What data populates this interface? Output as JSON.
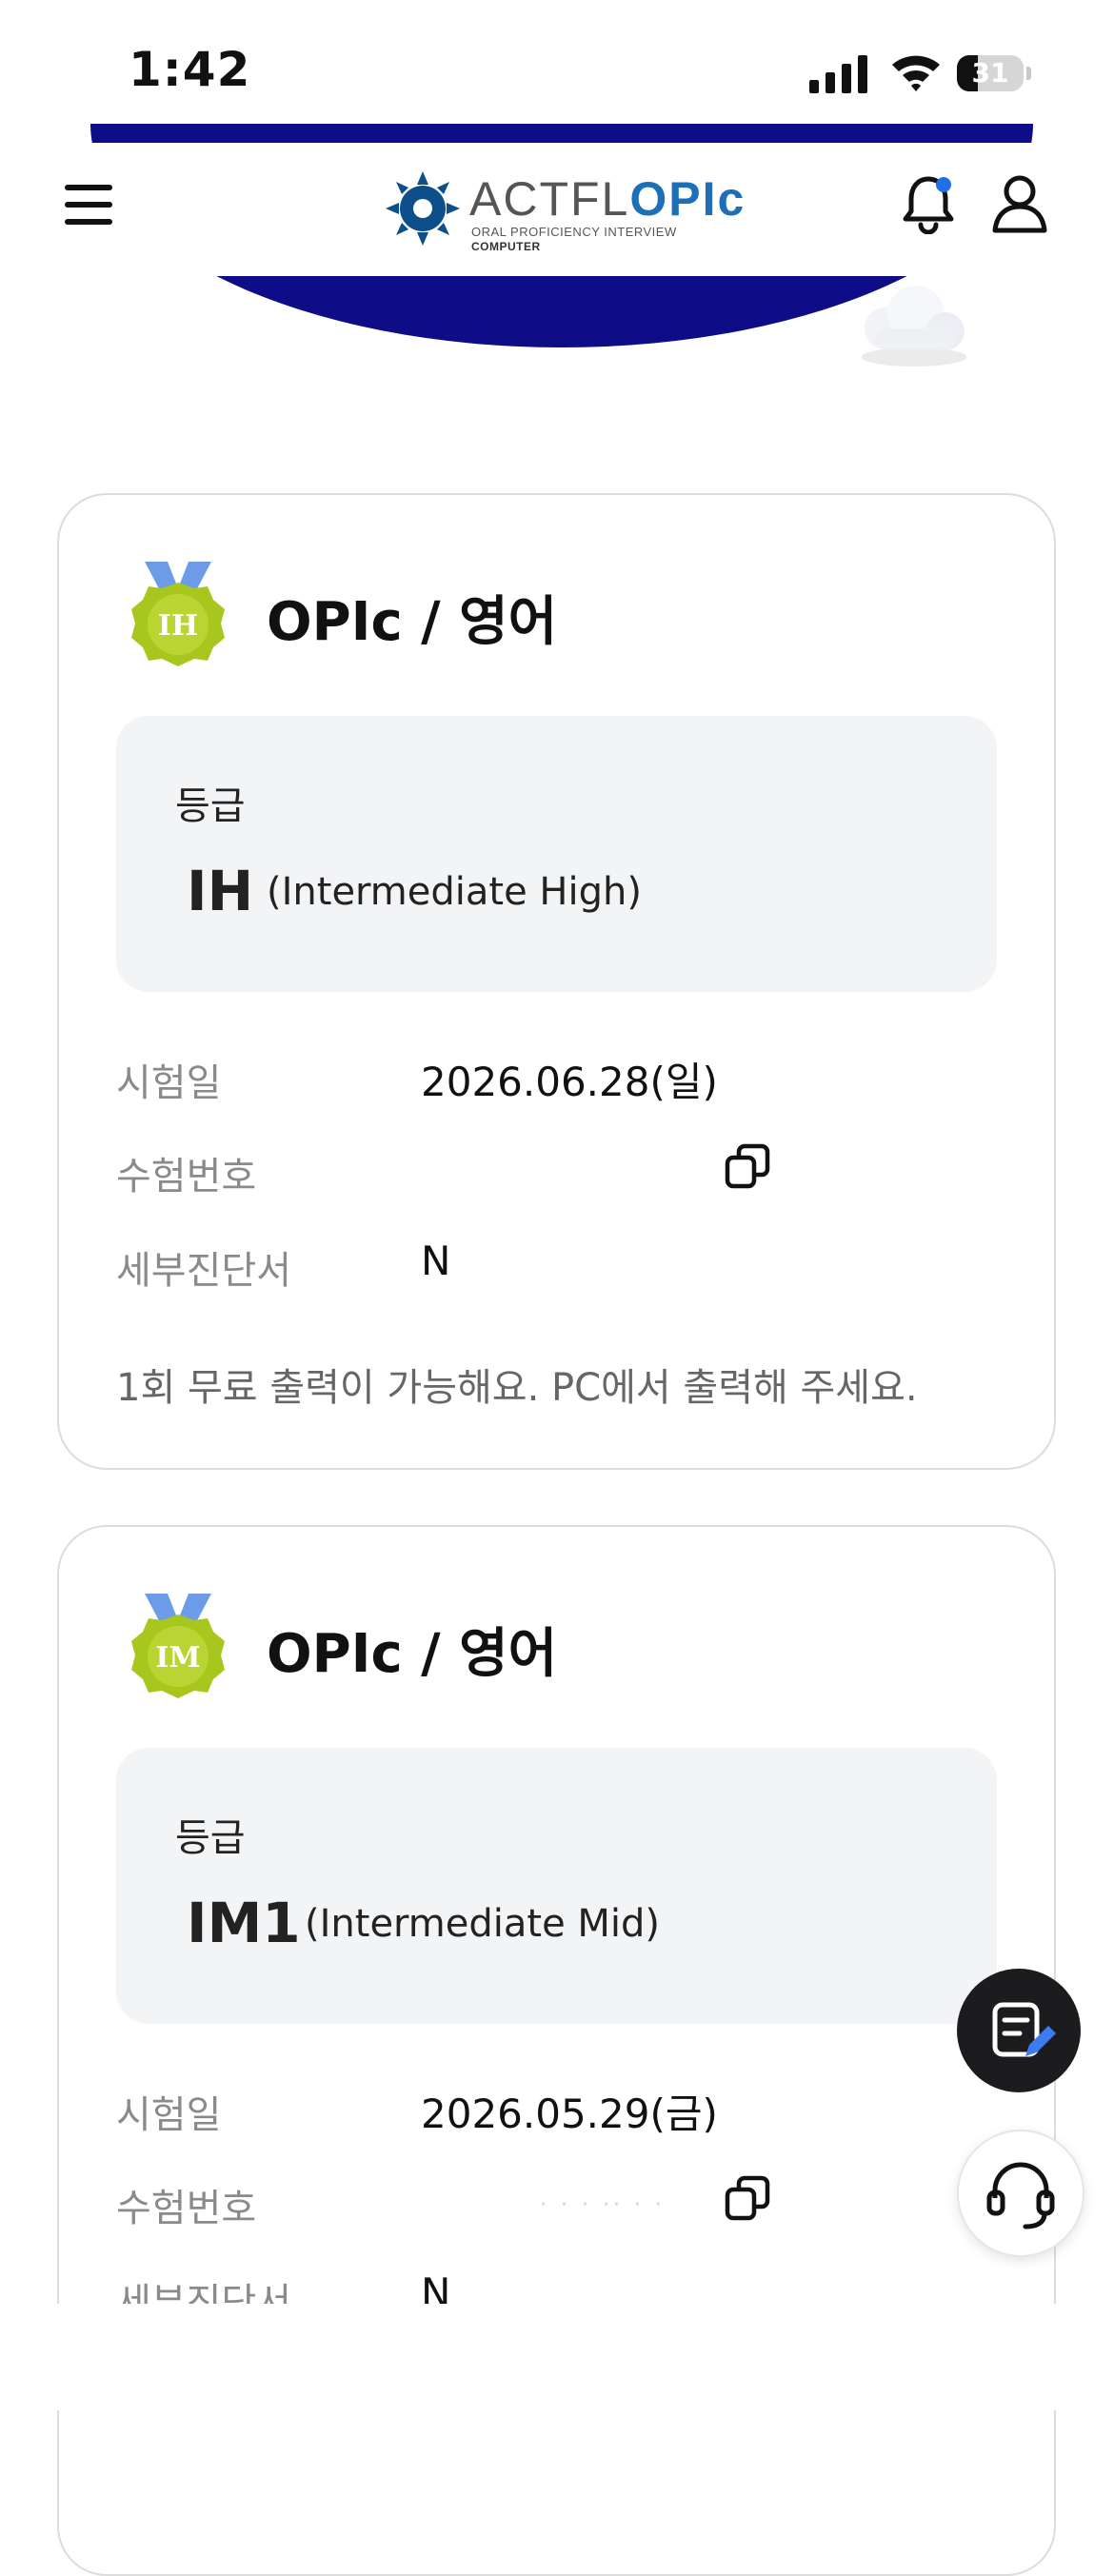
{
  "status_bar": {
    "time": "1:42",
    "battery": "31",
    "battery_level": 0.31
  },
  "header": {
    "logo_main": "ACTFL",
    "logo_accent": "OPIc",
    "logo_sub1": "ORAL PROFICIENCY INTERVIEW",
    "logo_sub2": "COMPUTER"
  },
  "cards": [
    {
      "medal": "IH",
      "title": "OPIc / 영어",
      "grade_label": "등급",
      "grade": "IH",
      "grade_desc": "(Intermediate High)",
      "exam_date_label": "시험일",
      "exam_date": "2026.06.28(일)",
      "exam_no_label": "수험번호",
      "detail_label": "세부진단서",
      "detail_value": "N",
      "note": "1회 무료 출력이 가능해요. PC에서 출력해 주세요."
    },
    {
      "medal": "IM",
      "title": "OPIc / 영어",
      "grade_label": "등급",
      "grade": "IM1",
      "grade_desc": "(Intermediate Mid)",
      "exam_date_label": "시험일",
      "exam_date": "2026.05.29(금)",
      "exam_no_label": "수험번호",
      "exam_no_masked": "· · · ·· · ·",
      "detail_label": "세부진단서",
      "detail_value": "N"
    }
  ],
  "icons": {
    "menu": "menu-icon",
    "bell": "bell-icon",
    "user": "user-icon",
    "copy": "copy-icon",
    "memo": "memo-edit-icon",
    "support": "headset-icon"
  },
  "colors": {
    "banner": "#0e0c86",
    "medal_green": "#a8c71e",
    "medal_ribbon": "#6c9be8",
    "notify_dot": "#1f6fe5",
    "brand_blue": "#1d6fb8"
  }
}
